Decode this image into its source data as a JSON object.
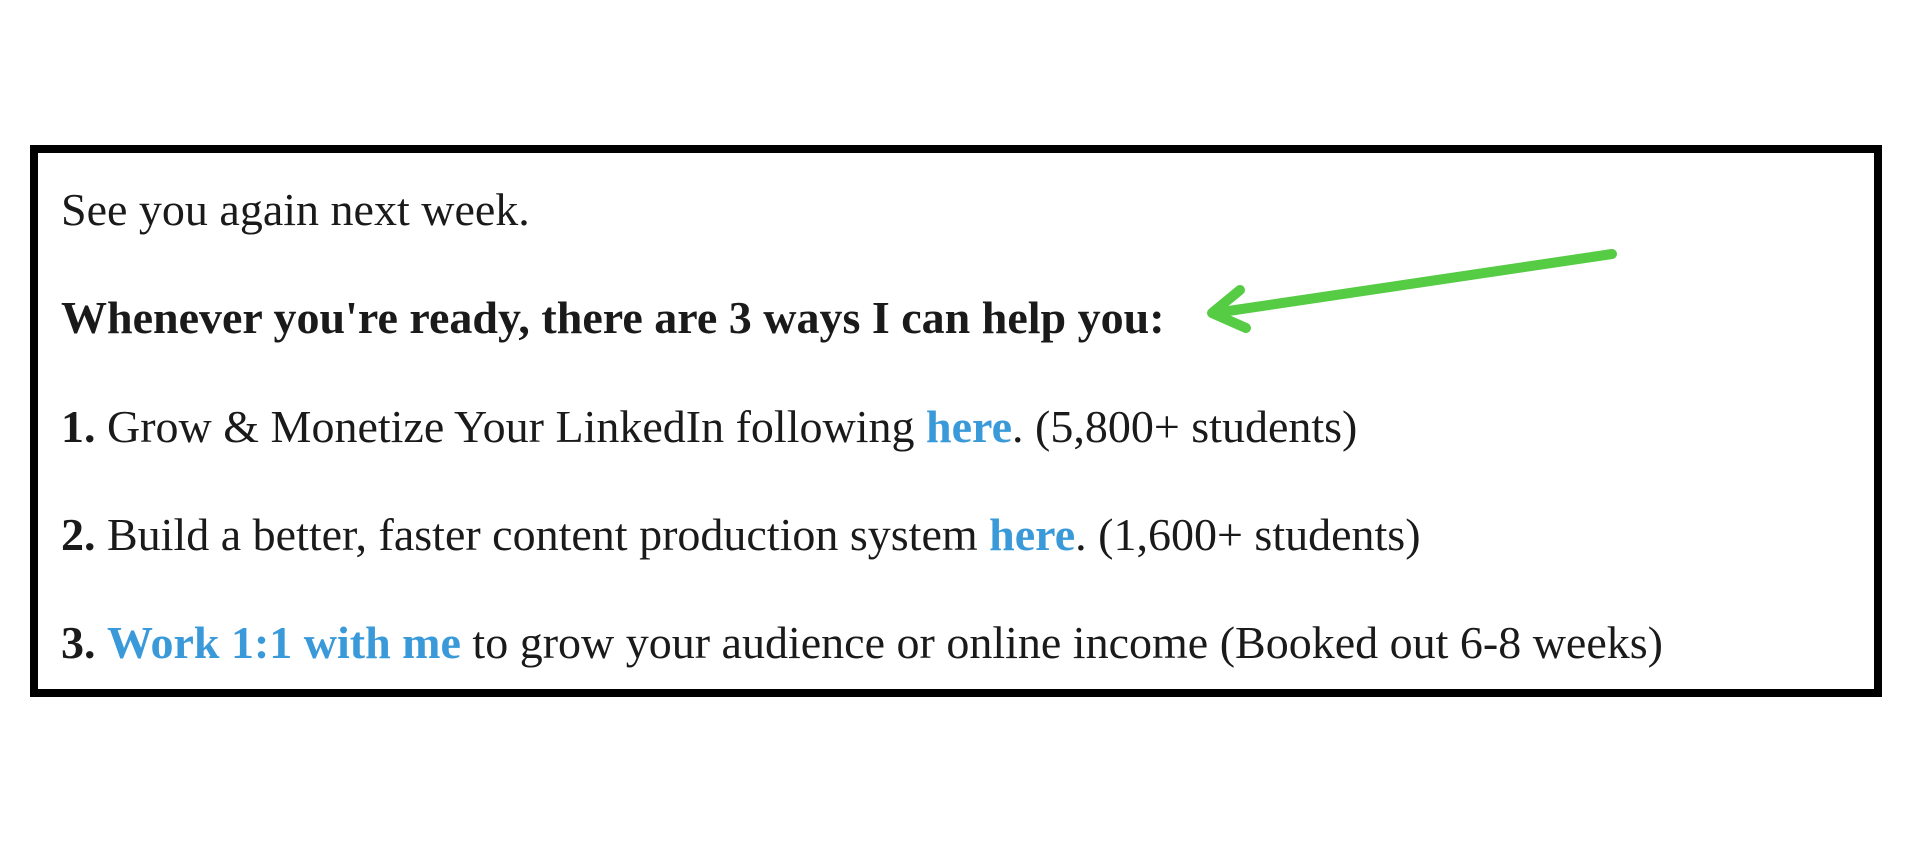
{
  "closing_line": "See you again next week.",
  "heading": "Whenever you're ready, there are 3 ways I can help you:",
  "items": [
    {
      "number": "1.",
      "text_before": "Grow & Monetize Your LinkedIn following",
      "link_text": "here",
      "text_after": ". (5,800+ students)"
    },
    {
      "number": "2.",
      "text_before": "Build a better, faster content production system",
      "link_text": "here",
      "text_after": ". (1,600+ students)"
    },
    {
      "number": "3.",
      "text_before": "",
      "link_text": "Work 1:1 with me",
      "text_after": "to grow your audience or online income (Booked out 6-8 weeks)"
    }
  ],
  "colors": {
    "link": "#3a9ad9",
    "arrow": "#55cc44",
    "border": "#000000"
  },
  "icons": {
    "arrow": "arrow-pointing-left-icon"
  }
}
